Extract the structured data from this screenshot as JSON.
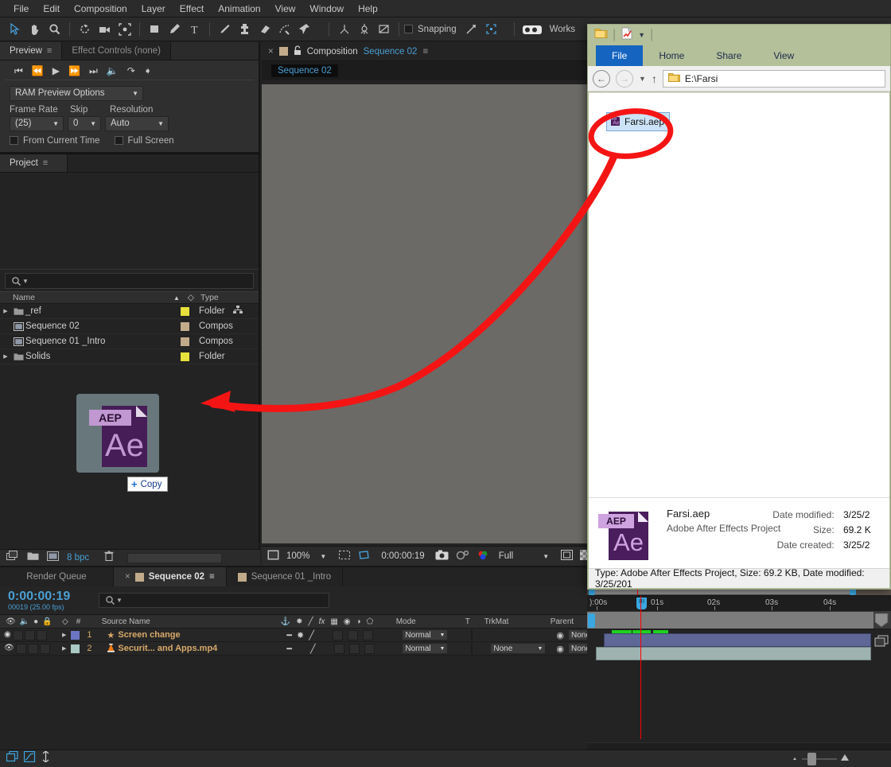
{
  "app": {
    "menu": [
      "File",
      "Edit",
      "Composition",
      "Layer",
      "Effect",
      "Animation",
      "View",
      "Window",
      "Help"
    ],
    "toolbar": {
      "snapping_label": "Snapping",
      "workspace_label": "Works",
      "tools": [
        "selection-tool",
        "hand-tool",
        "zoom-tool",
        "rotation-tool",
        "camera-tool",
        "pan-behind-tool",
        "shape-tool",
        "pen-tool",
        "type-tool",
        "brush-tool",
        "clone-stamp-tool",
        "eraser-tool",
        "roto-brush-tool",
        "puppet-pin-tool"
      ]
    }
  },
  "preview": {
    "tabs": [
      {
        "label": "Preview",
        "selected": true
      },
      {
        "label": "Effect Controls (none)",
        "selected": false
      }
    ],
    "ram_preview_options": "RAM Preview Options",
    "frame_rate_label": "Frame Rate",
    "frame_rate_value": "(25)",
    "skip_label": "Skip",
    "skip_value": "0",
    "resolution_label": "Resolution",
    "resolution_value": "Auto",
    "from_current_time": "From Current Time",
    "full_screen": "Full Screen"
  },
  "project": {
    "tab_label": "Project",
    "columns": [
      "Name",
      "Type"
    ],
    "items": [
      {
        "name": "_ref",
        "type": "Folder",
        "icon": "folder-icon",
        "expandable": true,
        "color": "#e8e03c"
      },
      {
        "name": "Sequence 02",
        "type": "Compos",
        "icon": "composition-icon",
        "expandable": false,
        "color": "#c2ab8a"
      },
      {
        "name": "Sequence 01 _Intro",
        "type": "Compos",
        "icon": "composition-icon",
        "expandable": false,
        "color": "#c2ab8a"
      },
      {
        "name": "Solids",
        "type": "Folder",
        "icon": "folder-icon",
        "expandable": true,
        "color": "#e8e03c"
      }
    ],
    "bit_depth": "8 bpc"
  },
  "composition": {
    "close_label": "x",
    "panel_label": "Composition",
    "comp_name": "Sequence 02",
    "breadcrumb_chip": "Sequence 02",
    "zoom": "100%",
    "time": "0:00:00:19",
    "quality": "Full"
  },
  "timeline": {
    "tabs": [
      {
        "label": "Render Queue",
        "selected": false,
        "has_swatch": false
      },
      {
        "label": "Sequence 02",
        "selected": true,
        "has_swatch": true
      },
      {
        "label": "Sequence 01 _Intro",
        "selected": false,
        "has_swatch": true
      }
    ],
    "timecode": "0:00:00:19",
    "frames": "00019 (25.00 fps)",
    "columns": [
      "#",
      "Source Name",
      "Mode",
      "T",
      "TrkMat",
      "Parent"
    ],
    "layers": [
      {
        "index": "1",
        "name": "Screen change",
        "icon": "star-icon",
        "mode": "Normal",
        "trkmat": "",
        "parent": "None",
        "color": "#6b75c4"
      },
      {
        "index": "2",
        "name": "Securit... and Apps.mp4",
        "icon": "vlc-icon",
        "mode": "Normal",
        "trkmat": "None",
        "parent": "None",
        "color": "#a8c9c4"
      }
    ],
    "ruler_ticks": [
      "):00s",
      "01s",
      "02s",
      "03s",
      "04s"
    ]
  },
  "explorer": {
    "ribbon_tabs": [
      "File",
      "Home",
      "Share",
      "View"
    ],
    "address": "E:\\Farsi",
    "file": {
      "name": "Farsi.aep",
      "badge_text": "AEP",
      "body_text": "Ae"
    },
    "details": {
      "name": "Farsi.aep",
      "type": "Adobe After Effects Project",
      "meta": [
        {
          "key": "Date modified:",
          "value": "3/25/2"
        },
        {
          "key": "Size:",
          "value": "69.2 K"
        },
        {
          "key": "Date created:",
          "value": "3/25/2"
        }
      ]
    },
    "status": "Type: Adobe After Effects Project, Size: 69.2 KB, Date modified: 3/25/201"
  },
  "drag": {
    "badge_label": "Copy",
    "badge_icon": "plus-icon",
    "ghost_badge": "AEP",
    "ghost_body": "Ae"
  },
  "annotation": {
    "color": "#f51414",
    "ellipse": "highlight-ellipse",
    "arrow": "pointer-arrow"
  }
}
